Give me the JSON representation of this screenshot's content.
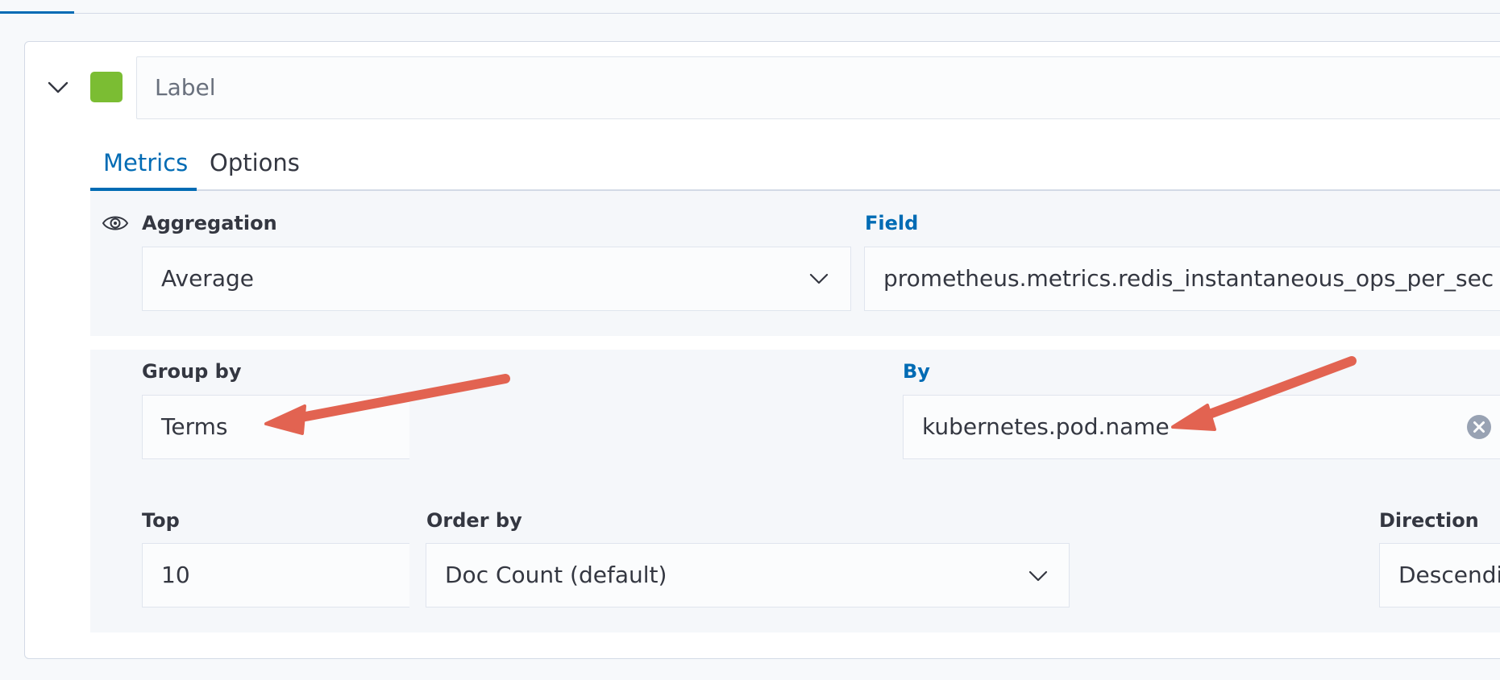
{
  "colors": {
    "accent": "#006bb4",
    "swatch": "#7bbd33",
    "arrow": "#e26351"
  },
  "series": {
    "label_placeholder": "Label"
  },
  "tabs": [
    {
      "label": "Metrics",
      "active": true
    },
    {
      "label": "Options",
      "active": false
    }
  ],
  "metric": {
    "aggregation_label": "Aggregation",
    "aggregation_value": "Average",
    "field_label": "Field",
    "field_value": "prometheus.metrics.redis_instantaneous_ops_per_sec"
  },
  "group": {
    "group_by_label": "Group by",
    "group_by_value": "Terms",
    "by_label": "By",
    "by_value": "kubernetes.pod.name",
    "top_label": "Top",
    "top_value": "10",
    "order_by_label": "Order by",
    "order_by_value": "Doc Count (default)",
    "direction_label": "Direction",
    "direction_value": "Descending"
  },
  "icons": {
    "toggle": "chevron-down-icon",
    "visibility": "eye-icon",
    "dropdown": "chevron-down-icon",
    "clear": "clear-icon",
    "annotation": "arrow-annotation"
  }
}
